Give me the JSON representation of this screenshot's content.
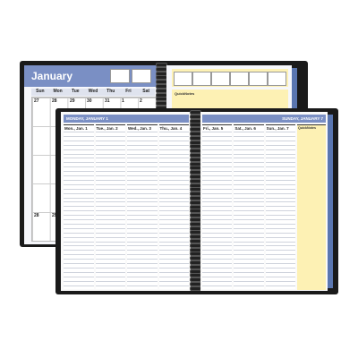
{
  "back_planner": {
    "month_title": "January",
    "weekdays": [
      "Sun",
      "Mon",
      "Tue",
      "Wed",
      "Thu",
      "Fri",
      "Sat"
    ],
    "first_row_dates": [
      "27",
      "28",
      "29",
      "30",
      "31",
      "1",
      "2"
    ],
    "bottom_row_dates": [
      "28",
      "29"
    ],
    "notes_title": "QuickNotes"
  },
  "front_planner": {
    "left_banner": "MONDAY, JANUARY 1",
    "right_banner": "SUNDAY, JANUARY 7",
    "left_days": [
      "Mon., Jan. 1",
      "Tue., Jan. 2",
      "Wed., Jan. 3",
      "Thu., Jan. 4"
    ],
    "right_days": [
      "Fri., Jan. 5",
      "Sat., Jan. 6",
      "Sun., Jan. 7"
    ],
    "notes_title": "QuickNotes"
  },
  "colors": {
    "cover": "#1a1a1a",
    "banner_blue": "#7a8fc4",
    "tab_blue": "#5a76b0",
    "notes_yellow": "#fdf1b4"
  }
}
